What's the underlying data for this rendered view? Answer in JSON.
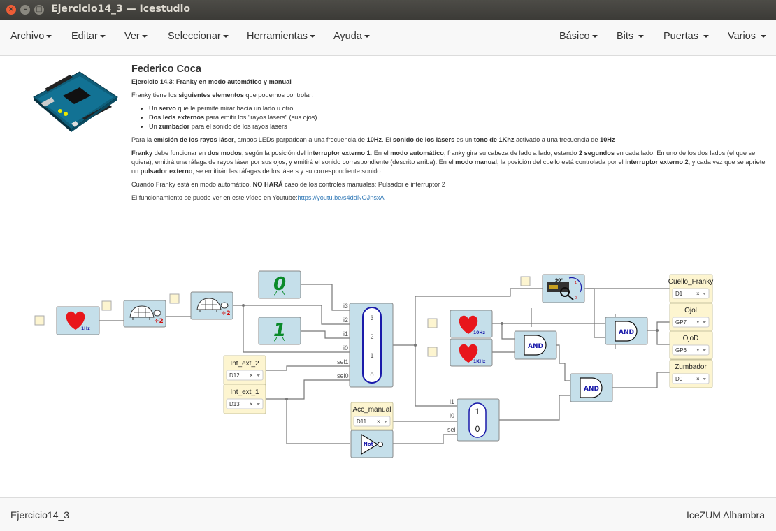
{
  "window": {
    "title": "Ejercicio14_3 — Icestudio"
  },
  "menubar": {
    "left": [
      "Archivo",
      "Editar",
      "Ver",
      "Seleccionar",
      "Herramientas",
      "Ayuda"
    ],
    "right": [
      "Básico",
      "Bits",
      "Puertas",
      "Varios"
    ]
  },
  "info": {
    "author": "Federico Coca",
    "exercise_prefix": "Ejercicio 14.3",
    "exercise_title": "Franky en modo automático y manual",
    "p1_a": "Franky tiene los ",
    "p1_b": "siguientes elementos",
    "p1_c": " que podemos controlar:",
    "li1_a": "Un ",
    "li1_b": "servo",
    "li1_c": " que le permite mirar hacia un lado u otro",
    "li2_a": "Dos leds externos",
    "li2_b": " para emitir los \"rayos lásers\" (sus ojos)",
    "li3_a": "Un ",
    "li3_b": "zumbador",
    "li3_c": " para el sonido de los rayos lásers",
    "p2_a": "Para la ",
    "p2_b": "emisión de los rayos láser",
    "p2_c": ", ambos LEDs parpadean a una frecuencia de ",
    "p2_d": "10Hz",
    "p2_e": ". El ",
    "p2_f": "sonido de los lásers",
    "p2_g": " es un ",
    "p2_h": "tono de 1Khz",
    "p2_i": " activado a una frecuencia de ",
    "p2_j": "10Hz",
    "p3_a": "Franky",
    "p3_b": " debe funcionar en ",
    "p3_c": "dos modos",
    "p3_d": ", según la posición del ",
    "p3_e": "interruptor externo 1",
    "p3_f": ". En el ",
    "p3_g": "modo automático",
    "p3_h": ", franky gira su cabeza de lado a lado, estando ",
    "p3_i": "2 segundos",
    "p3_j": " en cada lado. En uno de los dos lados (el que se quiera), emitirá una ráfaga de rayos láser por sus ojos, y emitirá el sonido correspondiente (descrito arriba). En el ",
    "p3_k": "modo manual",
    "p3_l": ", la posición del cuello está controlada por el ",
    "p3_m": "interruptor externo 2",
    "p3_n": ", y cada vez que se apriete un ",
    "p3_o": "pulsador externo",
    "p3_p": ", se emitirán las ráfagas de los lásers y su correspondiente sonido",
    "p4_a": "Cuando Franky está en modo automático, ",
    "p4_b": "NO HARÁ",
    "p4_c": " caso de los controles manuales: Pulsador e interruptor 2",
    "p5_a": "El funcionamiento se puede ver en este vídeo en Youtube:",
    "p5_link": "https://youtu.be/s4ddNOJnsxA"
  },
  "circuit": {
    "heart1_label": "1Hz",
    "heart2_label": "10Hz",
    "heart3_label": "1KHz",
    "div_label": "÷2",
    "const0": "0",
    "const1": "1",
    "mux4": {
      "inputs": [
        "i3",
        "i2",
        "i1",
        "i0",
        "sel1",
        "sel0"
      ],
      "values": [
        "3",
        "2",
        "1",
        "0"
      ]
    },
    "mux2": {
      "inputs": [
        "i1",
        "i0",
        "sel"
      ],
      "values": [
        "1",
        "0"
      ]
    },
    "servo_label": "90°",
    "and_label": "AND",
    "not_label": "Not",
    "inputs": [
      {
        "name": "Int_ext_2",
        "pin": "D12"
      },
      {
        "name": "Int_ext_1",
        "pin": "D13"
      },
      {
        "name": "Acc_manual",
        "pin": "D11"
      }
    ],
    "outputs": [
      {
        "name": "Cuello_Franky",
        "pin": "D1"
      },
      {
        "name": "Ojol",
        "pin": "GP7"
      },
      {
        "name": "OjoD",
        "pin": "GP6"
      },
      {
        "name": "Zumbador",
        "pin": "D0"
      }
    ],
    "select_clear": "×",
    "colors": {
      "block": "#c5dfea",
      "io": "#fdf5d0",
      "heart": "#e8161b",
      "mux_ring": "#1a1aaa",
      "const": "#0a8a2a"
    }
  },
  "status": {
    "left": "Ejercicio14_3",
    "right": "IceZUM Alhambra"
  }
}
